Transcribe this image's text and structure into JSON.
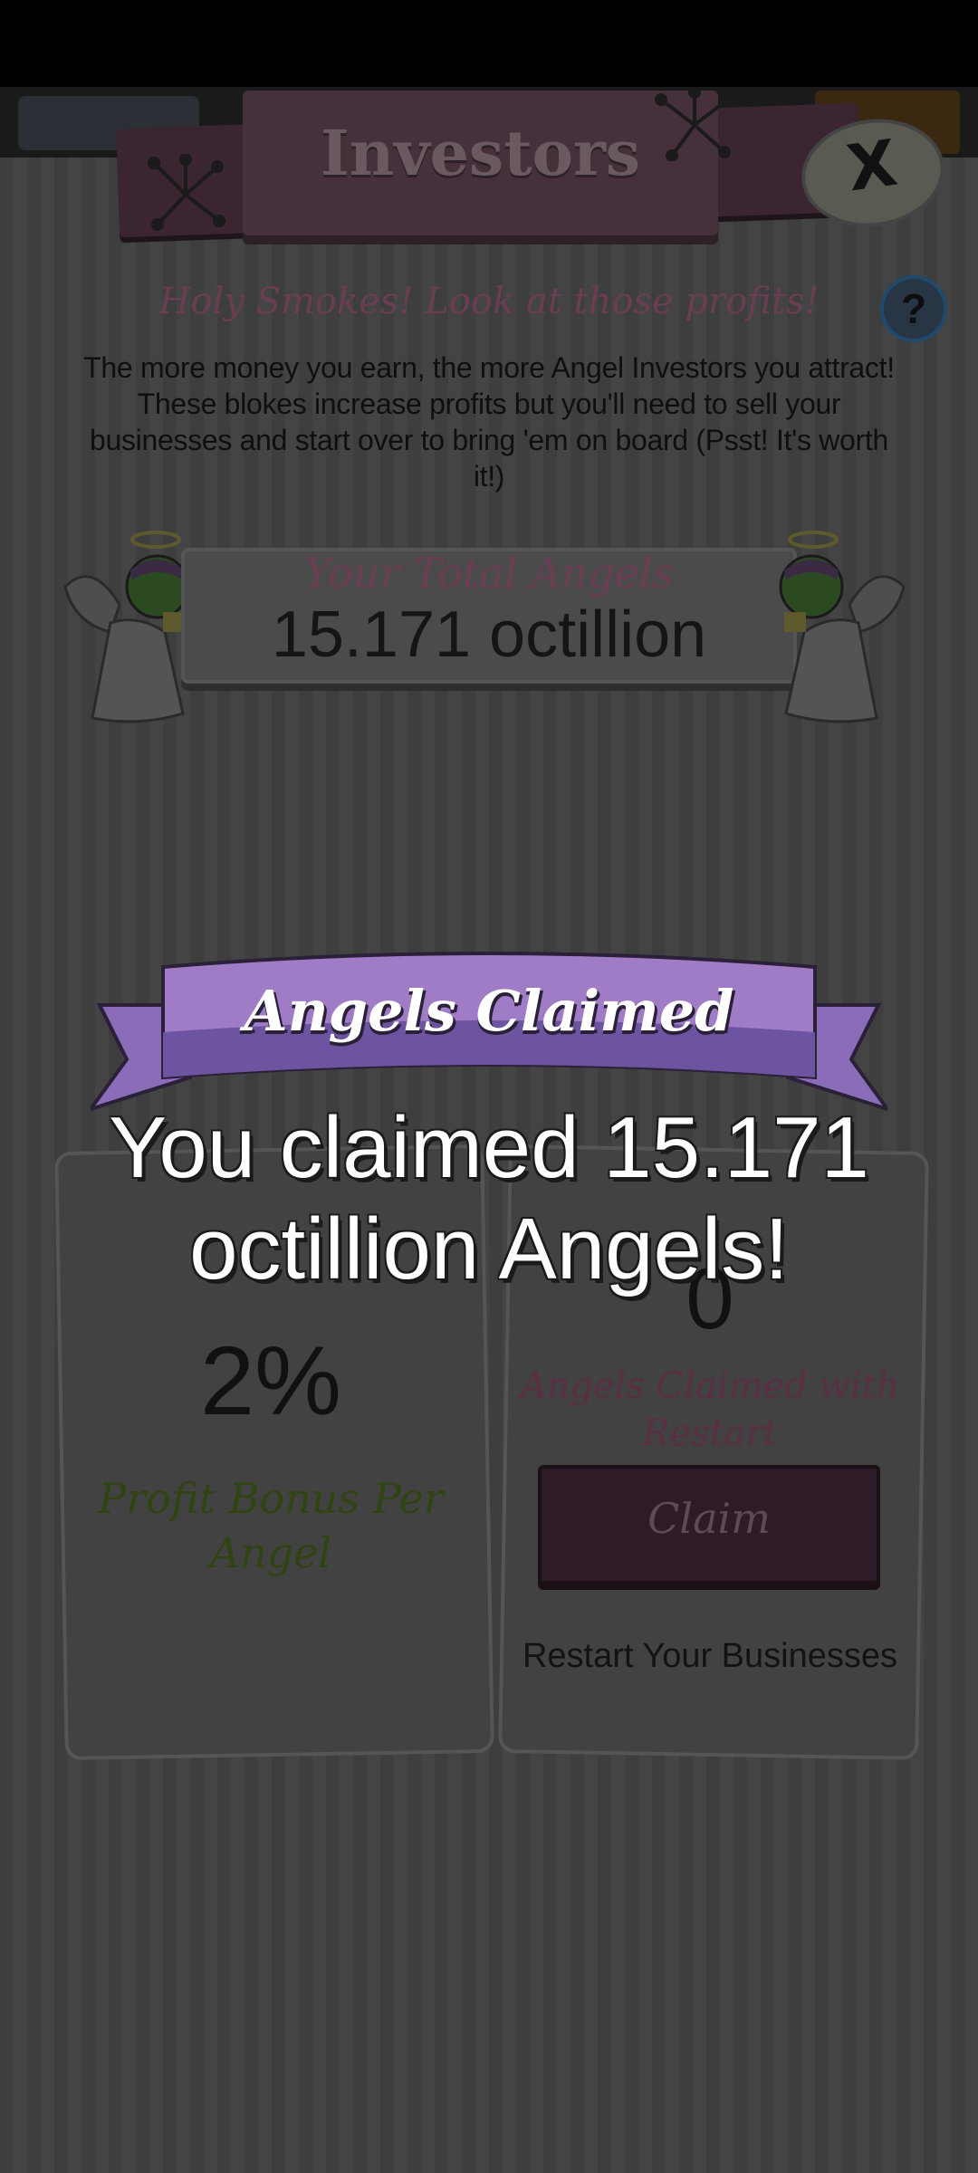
{
  "header": {
    "title": "Investors",
    "close_label": "X"
  },
  "help_label": "?",
  "subtitle": "Holy Smokes! Look at those profits!",
  "description": "The more money you earn, the more Angel Investors you attract! These blokes increase profits but you'll need to sell your businesses and start over to bring 'em on board (Psst! It's worth it!)",
  "total_angels": {
    "label": "Your Total Angels",
    "value": "15.171 octillion"
  },
  "profit_bonus": {
    "value": "2%",
    "label": "Profit Bonus Per Angel"
  },
  "claim_panel": {
    "value": "0",
    "label": "Angels Claimed with Restart",
    "button_label": "Claim",
    "restart_label": "Restart Your Businesses"
  },
  "popup": {
    "title": "Angels Claimed",
    "message": "You claimed 15.171 octillion Angels!"
  },
  "colors": {
    "ribbon_purple": "#a07cc7",
    "ribbon_dark": "#6d54a0",
    "panel_bg": "#3e3e3e",
    "subtitle_color": "#6b3d53",
    "bonus_color": "#304411"
  }
}
